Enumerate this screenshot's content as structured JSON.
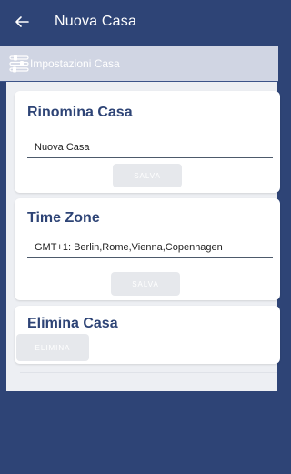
{
  "appbar": {
    "title": "Nuova Casa",
    "back_icon": "arrow-left-icon"
  },
  "subbar": {
    "label": "Impostazioni Casa",
    "icon": "settings-sliders-icon"
  },
  "rename": {
    "title": "Rinomina Casa",
    "value": "Nuova Casa",
    "save_label": "SALVA"
  },
  "timezone": {
    "title": "Time Zone",
    "value": "GMT+1:  Berlin,Rome,Vienna,Copenhagen",
    "save_label": "SALVA"
  },
  "delete": {
    "title": "Elimina Casa",
    "delete_label": "ELIMINA"
  },
  "colors": {
    "primary": "#2e4476",
    "subbar": "#d0d5e3",
    "button_disabled": "#e6e8ec"
  }
}
